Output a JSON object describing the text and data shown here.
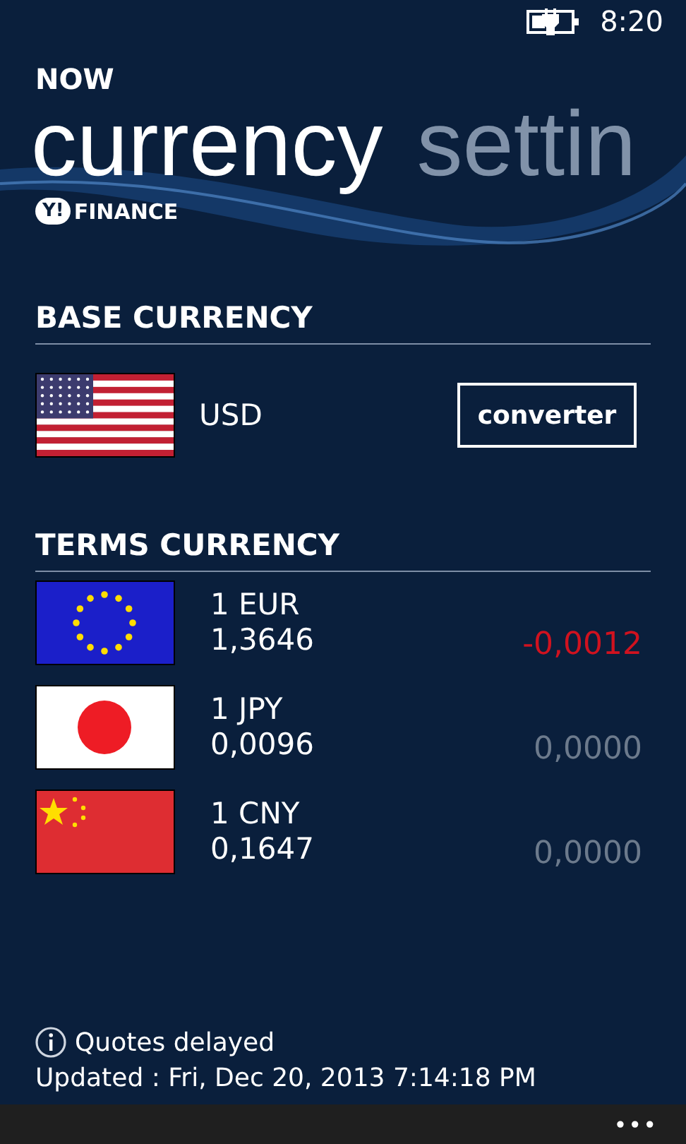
{
  "status_bar": {
    "time": "8:20"
  },
  "app_title": "NOW",
  "pivot": [
    {
      "label": "currency",
      "selected": true
    },
    {
      "label": "settin",
      "selected": false
    }
  ],
  "logo": {
    "mark": "Y!",
    "name": "FINANCE"
  },
  "base": {
    "heading": "BASE CURRENCY",
    "flag": {
      "kind": "us"
    },
    "code": "USD",
    "button": "converter"
  },
  "terms": {
    "heading": "TERMS CURRENCY",
    "rows": [
      {
        "flag": {
          "kind": "eu"
        },
        "unit": "1 EUR",
        "rate": "1,3646",
        "change": "-0,0012",
        "color": "#d0121f"
      },
      {
        "flag": {
          "kind": "jp"
        },
        "unit": "1 JPY",
        "rate": "0,0096",
        "change": "0,0000",
        "color": "#6c7a8c"
      },
      {
        "flag": {
          "kind": "cn"
        },
        "unit": "1 CNY",
        "rate": "0,1647",
        "change": "0,0000",
        "color": "#6c7a8c"
      }
    ]
  },
  "footer": {
    "notice": "Quotes delayed",
    "updated": "Updated : Fri, Dec 20, 2013 7:14:18 PM"
  },
  "app_bar": {
    "more": "•••"
  }
}
